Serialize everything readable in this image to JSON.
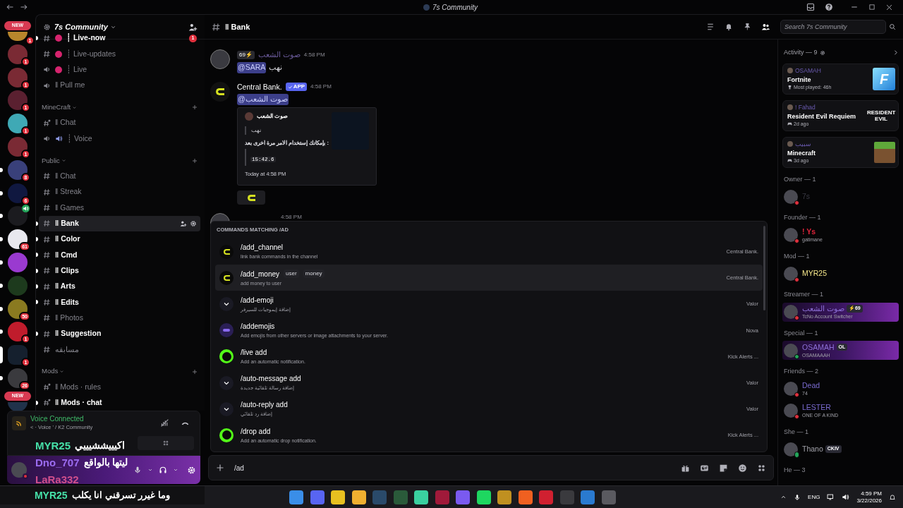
{
  "window": {
    "title": "7s Community"
  },
  "servers": [
    {
      "badge": "1",
      "new_label": "NEW",
      "unread": false,
      "selected": false
    },
    {
      "badge": "1",
      "unread": false,
      "selected": false
    },
    {
      "badge": "1",
      "unread": false,
      "selected": false
    },
    {
      "badge": "1",
      "unread": false,
      "selected": false
    },
    {
      "badge": "1",
      "unread": false,
      "selected": false
    },
    {
      "badge": "1",
      "unread": false,
      "selected": false
    },
    {
      "badge": "8",
      "unread": true,
      "selected": false
    },
    {
      "badge": "6",
      "unread": true,
      "selected": false
    },
    {
      "voice": true,
      "unread": true,
      "selected": false
    },
    {
      "badge": "61",
      "unread": true,
      "selected": false
    },
    {
      "unread": true,
      "selected": false
    },
    {
      "unread": true,
      "selected": false
    },
    {
      "badge": "50",
      "unread": true,
      "selected": false
    },
    {
      "badge": "1",
      "unread": true,
      "selected": false
    },
    {
      "badge": "1",
      "unread": false,
      "selected": true
    },
    {
      "badge": "26",
      "unread": true,
      "selected": false
    },
    {
      "new_label": "NEW",
      "unread": false,
      "selected": false
    }
  ],
  "server_header": {
    "name": "7s Community"
  },
  "channel_groups": [
    {
      "channels": [
        {
          "name": "┊ Live-now",
          "kind": "text",
          "color": "#d6246e",
          "unread": true,
          "selected": false,
          "badge": "1"
        },
        {
          "name": "┊ Live-updates",
          "kind": "text",
          "color": "#d6246e",
          "unread": false,
          "selected": false
        },
        {
          "name": "┊ Live",
          "kind": "voice-locked",
          "color": "#d6246e",
          "unread": false,
          "selected": false
        },
        {
          "name": "ǁ Pull me",
          "kind": "voice",
          "unread": false,
          "selected": false
        }
      ]
    },
    {
      "title": "MineCraft",
      "channels": [
        {
          "name": "ǁ Chat",
          "kind": "text-locked",
          "unread": false,
          "selected": false
        },
        {
          "name": "┊ Voice",
          "kind": "voice-speaker",
          "unread": false,
          "selected": false
        }
      ]
    },
    {
      "title": "Public",
      "channels": [
        {
          "name": "ǁ Chat",
          "kind": "text",
          "unread": false,
          "selected": false
        },
        {
          "name": "ǁ Streak",
          "kind": "text",
          "unread": false,
          "selected": false
        },
        {
          "name": "ǁ Games",
          "kind": "text",
          "unread": false,
          "selected": false
        },
        {
          "name": "ǁ Bank",
          "kind": "text",
          "unread": true,
          "selected": true
        },
        {
          "name": "ǁ Color",
          "kind": "text",
          "unread": true,
          "selected": false
        },
        {
          "name": "ǁ Cmd",
          "kind": "text",
          "unread": true,
          "selected": false
        },
        {
          "name": "ǁ Clips",
          "kind": "text",
          "unread": true,
          "selected": false
        },
        {
          "name": "ǁ Arts",
          "kind": "text",
          "unread": true,
          "selected": false
        },
        {
          "name": "ǁ Edits",
          "kind": "text",
          "unread": true,
          "selected": false
        },
        {
          "name": "ǁ Photos",
          "kind": "text",
          "unread": false,
          "selected": false
        },
        {
          "name": "ǁ Suggestion",
          "kind": "text",
          "unread": true,
          "selected": false
        },
        {
          "name": "مسابقه",
          "kind": "text",
          "unread": false,
          "selected": false
        }
      ]
    },
    {
      "title": "Mods",
      "channels": [
        {
          "name": "ǁ Mods · rules",
          "kind": "text-locked",
          "unread": false,
          "selected": false
        },
        {
          "name": "ǁ Mods · chat",
          "kind": "text-locked",
          "unread": true,
          "selected": false
        }
      ]
    }
  ],
  "voice_panel": {
    "status": "Voice Connected",
    "location": "< · Voice ' / K2 Community"
  },
  "channel_header": {
    "name": "ǁ Bank",
    "search_placeholder": "Search 7s Community"
  },
  "messages": [
    {
      "author": "صوت الشعب",
      "tag": "69⚡",
      "time": "4:58 PM",
      "mention": "@SARA",
      "text": "نهب"
    },
    {
      "author": "Central Bank.",
      "app_badge": "APP",
      "time": "4:58 PM",
      "mention": "@صوت الشعب",
      "embed": {
        "author": "صوت الشعب",
        "quote": "نهب",
        "text": "بإمكانك إستخدام الامر مرة اخرى بعد :",
        "code": "15:42.6",
        "footer": "Today at 4:58 PM"
      },
      "button": true
    },
    {
      "time": "4:58 PM"
    }
  ],
  "command_popup": {
    "title": "COMMANDS MATCHING /AD",
    "commands": [
      {
        "name": "/add_channel",
        "description": "link bank commands in the channel",
        "app": "Central Bank.",
        "kind": "central",
        "selected": false
      },
      {
        "name": "/add_money",
        "options": [
          "user",
          "money"
        ],
        "description": "add money to user",
        "app": "Central Bank.",
        "kind": "central",
        "selected": true
      },
      {
        "name": "/add-emoji",
        "description": "إضافة إيموجيات للسيرفر",
        "app": "Valor",
        "kind": "valor",
        "selected": false
      },
      {
        "name": "/addemojis",
        "description": "Add emojis from other servers or image attachments to your server.",
        "app": "Nova",
        "kind": "nova",
        "selected": false
      },
      {
        "name": "/live add",
        "description": "Add an automatic notification.",
        "app": "Kick Alerts ...",
        "kind": "kick",
        "selected": false
      },
      {
        "name": "/auto-message add",
        "description": "إضافة رسالة تلقائية جديدة",
        "app": "Valor",
        "kind": "valor",
        "selected": false
      },
      {
        "name": "/auto-reply add",
        "description": "إضافة رد تلقائي",
        "app": "Valor",
        "kind": "valor",
        "selected": false
      },
      {
        "name": "/drop add",
        "description": "Add an automatic drop notification.",
        "app": "Kick Alerts ...",
        "kind": "kick",
        "selected": false
      }
    ]
  },
  "composer": {
    "value": "/ad"
  },
  "activity": {
    "title": "Activity — 9",
    "cards": [
      {
        "user": "OSAMAH",
        "game": "Fortnite",
        "detail": "Most played: 46h",
        "kind": "cover",
        "art_text": "F"
      },
      {
        "user": "! Fahad",
        "game": "Resident Evil Requiem",
        "detail": "2d ago",
        "kind": "logo",
        "art_text": "RESIDENT EVIL"
      },
      {
        "user": "سبيب",
        "game": "Minecraft",
        "detail": "3d ago",
        "kind": "block"
      }
    ]
  },
  "member_groups": [
    {
      "title": "Owner — 1",
      "members": [
        {
          "name": "7s",
          "color": "#3a3a44",
          "kind": "dnd"
        }
      ]
    },
    {
      "title": "Founder — 1",
      "members": [
        {
          "name": "! Ys",
          "color": "#e0243b",
          "kind": "dnd",
          "sub": "gatimane"
        }
      ]
    },
    {
      "title": "Mod — 1",
      "members": [
        {
          "name": "MYR25",
          "color": "#f5e68a",
          "kind": "dnd"
        }
      ]
    },
    {
      "title": "Streamer — 1",
      "members": [
        {
          "name": "صوت الشعب",
          "color": "#8c6fd6",
          "kind": "dnd",
          "tag": "⚡69",
          "sub": "TcNo Account Switcher",
          "banner": true
        }
      ]
    },
    {
      "title": "Special — 1",
      "members": [
        {
          "name": "OSAMAH",
          "color": "#8c6fd6",
          "kind": "online",
          "tag": "OL",
          "sub": "OSAMAAAH",
          "banner": true
        }
      ]
    },
    {
      "title": "Friends — 2",
      "members": [
        {
          "name": "Dead",
          "color": "#7a6bd0",
          "kind": "dnd",
          "sub": "74"
        },
        {
          "name": "LESTER",
          "color": "#7a6bd0",
          "kind": "dnd",
          "sub": "ONE OF A KIND"
        }
      ]
    },
    {
      "title": "She — 1",
      "members": [
        {
          "name": "Thano",
          "kind": "mobile",
          "tag": "CKIV"
        }
      ]
    },
    {
      "title": "He — 3"
    }
  ],
  "stream_overlay": [
    {
      "user": "MYR25",
      "color": "#46e0a8",
      "text": "اكيييششيييي"
    },
    {
      "user": "Dno_707",
      "color": "#9b6cf0",
      "text": "ليتها بالواقع"
    },
    {
      "user": "LaRa332",
      "color": "#d04f8c"
    }
  ],
  "stream_caption": {
    "user": "MYR25",
    "color": "#46e0a8",
    "text": "وما غيرر تسرقني انا يكلب"
  },
  "tray": {
    "language": "ENG",
    "time": "4:59 PM",
    "date": "3/22/2026"
  }
}
